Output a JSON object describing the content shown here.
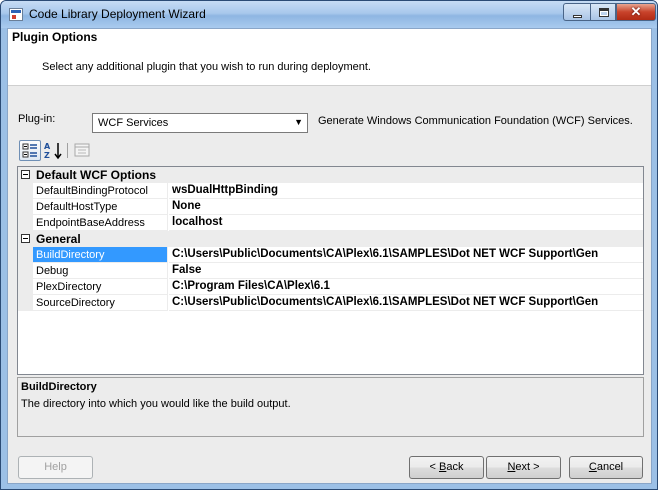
{
  "window": {
    "title": "Code Library Deployment Wizard",
    "close_glyph": "✕"
  },
  "header": {
    "title": "Plugin Options",
    "description": "Select any additional plugin that you wish to run during deployment."
  },
  "plugin": {
    "label": "Plug-in:",
    "selected": "WCF Services",
    "arrow": "▼",
    "description": "Generate Windows Communication Foundation (WCF) Services."
  },
  "toolbar": {
    "categorized_icon": "categorized-icon",
    "alphabetical_icon": "alphabetical-icon",
    "property_pages_icon": "property-pages-icon"
  },
  "grid": {
    "categories": [
      {
        "name": "Default WCF Options",
        "properties": [
          {
            "name": "DefaultBindingProtocol",
            "value": "wsDualHttpBinding"
          },
          {
            "name": "DefaultHostType",
            "value": "None"
          },
          {
            "name": "EndpointBaseAddress",
            "value": "localhost"
          }
        ]
      },
      {
        "name": "General",
        "properties": [
          {
            "name": "BuildDirectory",
            "value": "C:\\Users\\Public\\Documents\\CA\\Plex\\6.1\\SAMPLES\\Dot NET WCF Support\\Gen"
          },
          {
            "name": "Debug",
            "value": "False"
          },
          {
            "name": "PlexDirectory",
            "value": "C:\\Program Files\\CA\\Plex\\6.1"
          },
          {
            "name": "SourceDirectory",
            "value": "C:\\Users\\Public\\Documents\\CA\\Plex\\6.1\\SAMPLES\\Dot NET WCF Support\\Gen"
          }
        ]
      }
    ],
    "selected_property": "BuildDirectory"
  },
  "description_panel": {
    "title": "BuildDirectory",
    "text": "The directory into which you would like the build output."
  },
  "buttons": {
    "help": "Help",
    "back_prefix": "< ",
    "back_mnemonic": "B",
    "back_rest": "ack",
    "next_mnemonic": "N",
    "next_rest": "ext >",
    "cancel_mnemonic": "C",
    "cancel_rest": "ancel"
  }
}
